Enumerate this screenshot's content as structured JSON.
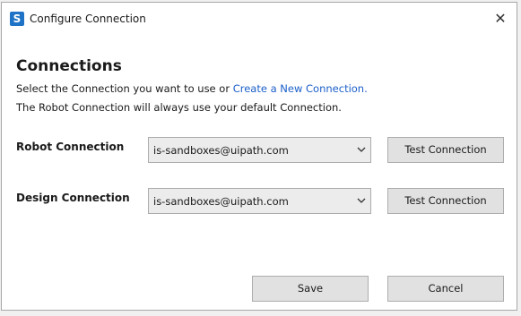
{
  "window": {
    "title": "Configure Connection",
    "icon": "uipath-studio-icon",
    "close_glyph": "✕"
  },
  "main": {
    "heading": "Connections",
    "instruction_prefix": "Select the Connection you want to use or ",
    "create_link": "Create a New Connection.",
    "note": "The Robot Connection will always use your default Connection."
  },
  "rows": [
    {
      "label": "Robot Connection",
      "selected": "is-sandboxes@uipath.com",
      "test_label": "Test Connection"
    },
    {
      "label": "Design Connection",
      "selected": "is-sandboxes@uipath.com",
      "test_label": "Test Connection"
    }
  ],
  "footer": {
    "save_label": "Save",
    "cancel_label": "Cancel"
  },
  "colors": {
    "link": "#1b5fc9",
    "accent_icon": "#1f73c7"
  }
}
